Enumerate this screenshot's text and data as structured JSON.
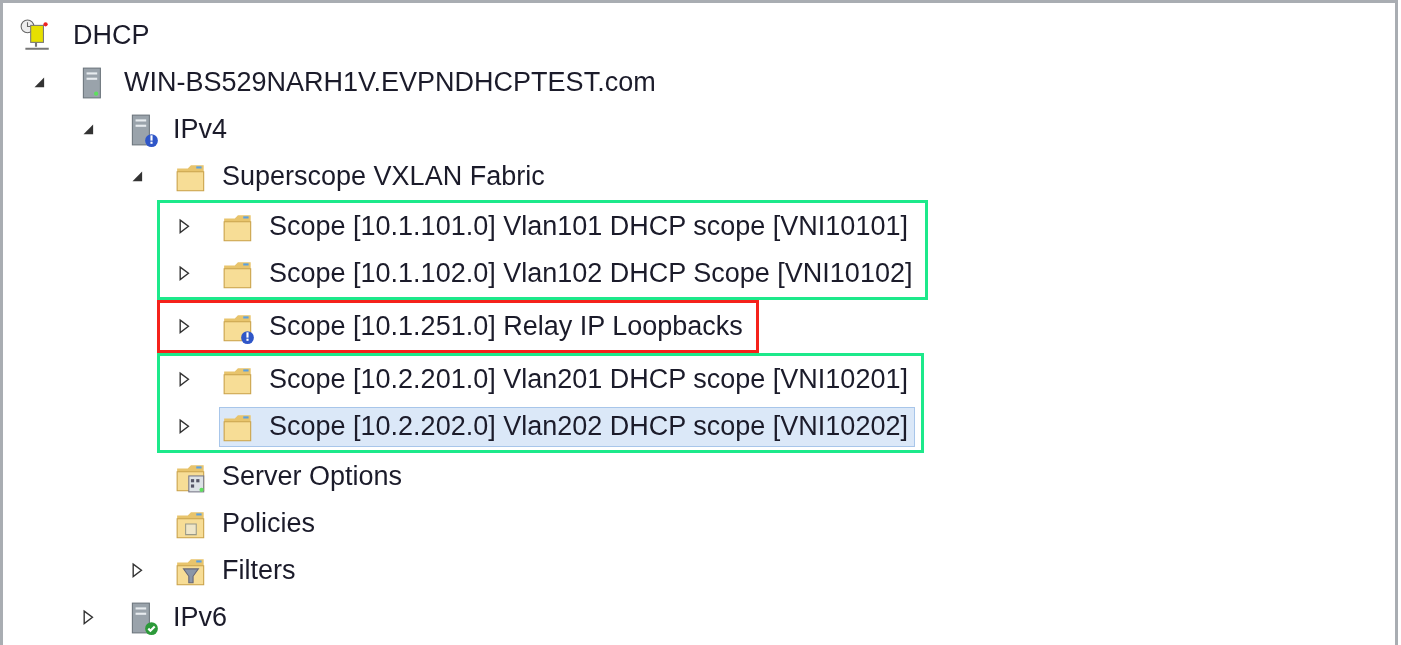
{
  "tree": [
    {
      "label": "DHCP",
      "kind": "root",
      "children": [
        {
          "label": "WIN-BS529NARH1V.EVPNDHCPTEST.com",
          "kind": "server",
          "expanded": true,
          "children": [
            {
              "label": "IPv4",
              "kind": "ipv4",
              "expanded": true,
              "children": [
                {
                  "label": "Superscope VXLAN Fabric",
                  "kind": "superscope",
                  "expanded": true,
                  "groups": [
                    {
                      "color": "#1de98b",
                      "items": [
                        {
                          "label": "Scope [10.1.101.0] Vlan101 DHCP scope [VNI10101]",
                          "kind": "scope",
                          "expanded": false,
                          "selected": false
                        },
                        {
                          "label": "Scope [10.1.102.0] Vlan102 DHCP Scope [VNI10102]",
                          "kind": "scope",
                          "expanded": false,
                          "selected": false
                        }
                      ]
                    },
                    {
                      "color": "#f5221b",
                      "items": [
                        {
                          "label": "Scope [10.1.251.0] Relay IP Loopbacks",
                          "kind": "scope-alert",
                          "expanded": false,
                          "selected": false
                        }
                      ]
                    },
                    {
                      "color": "#1de98b",
                      "items": [
                        {
                          "label": "Scope [10.2.201.0] Vlan201 DHCP scope [VNI10201]",
                          "kind": "scope",
                          "expanded": false,
                          "selected": false
                        },
                        {
                          "label": "Scope [10.2.202.0] Vlan202 DHCP scope [VNI10202]",
                          "kind": "scope",
                          "expanded": false,
                          "selected": true
                        }
                      ]
                    }
                  ]
                },
                {
                  "label": "Server Options",
                  "kind": "options"
                },
                {
                  "label": "Policies",
                  "kind": "policies"
                },
                {
                  "label": "Filters",
                  "kind": "filters",
                  "expanded": false
                }
              ]
            },
            {
              "label": "IPv6",
              "kind": "ipv6",
              "expanded": false
            }
          ]
        }
      ]
    }
  ]
}
